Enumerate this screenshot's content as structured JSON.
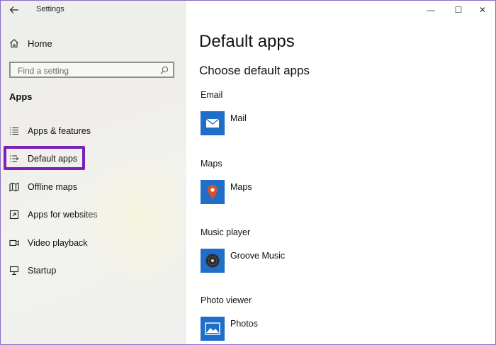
{
  "window": {
    "title": "Settings",
    "controls": {
      "minimize": "—",
      "maximize": "☐",
      "close": "✕"
    }
  },
  "sidebar": {
    "home_label": "Home",
    "search": {
      "placeholder": "Find a setting",
      "value": ""
    },
    "section_title": "Apps",
    "items": [
      {
        "label": "Apps & features",
        "icon": "list-icon"
      },
      {
        "label": "Default apps",
        "icon": "default-apps-icon",
        "selected": true
      },
      {
        "label": "Offline maps",
        "icon": "map-icon"
      },
      {
        "label": "Apps for websites",
        "icon": "open-in-window-icon"
      },
      {
        "label": "Video playback",
        "icon": "video-icon"
      },
      {
        "label": "Startup",
        "icon": "startup-icon"
      }
    ]
  },
  "main": {
    "page_title": "Default apps",
    "subtitle": "Choose default apps",
    "categories": [
      {
        "label": "Email",
        "app": "Mail",
        "icon": "mail-icon"
      },
      {
        "label": "Maps",
        "app": "Maps",
        "icon": "maps-pin-icon"
      },
      {
        "label": "Music player",
        "app": "Groove Music",
        "icon": "groove-music-icon"
      },
      {
        "label": "Photo viewer",
        "app": "Photos",
        "icon": "photos-icon"
      }
    ]
  },
  "colors": {
    "accent": "#1f6fc8",
    "highlight": "#7b1fb5",
    "sidebar_bg": "#efefec"
  }
}
